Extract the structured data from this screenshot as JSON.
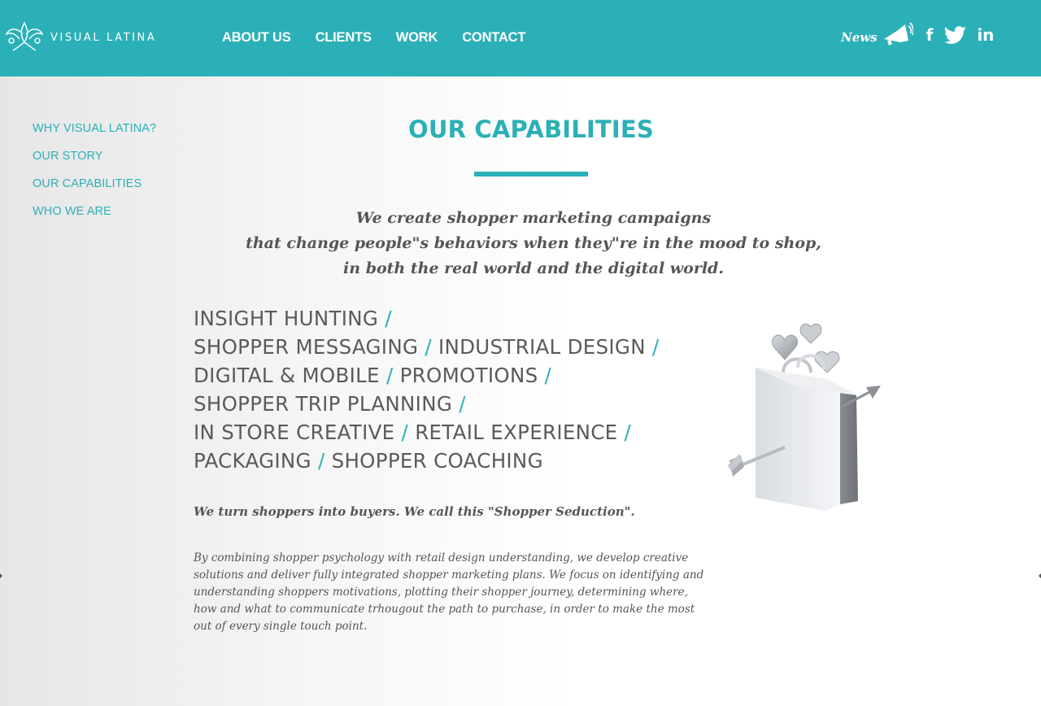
{
  "header": {
    "logo_text": "VISUAL LATINA",
    "nav": [
      "ABOUT US",
      "CLIENTS",
      "WORK",
      "CONTACT"
    ],
    "news_label": "News",
    "social_icons": [
      "megaphone-icon",
      "facebook-icon",
      "twitter-icon",
      "linkedin-icon"
    ],
    "facebook_glyph": "f",
    "linkedin_glyph": "in"
  },
  "sidebar": {
    "items": [
      "WHY VISUAL LATINA?",
      "OUR STORY",
      "OUR CAPABILITIES",
      "WHO WE ARE"
    ]
  },
  "main": {
    "title": "OUR CAPABILITIES",
    "intro_lines": [
      "We create shopper marketing campaigns",
      "that change people\"s behaviors when they\"re in the mood to shop,",
      "in both the real world and the digital world."
    ],
    "capabilities": [
      "INSIGHT HUNTING",
      "SHOPPER MESSAGING",
      "INDUSTRIAL DESIGN",
      "DIGITAL & MOBILE",
      "PROMOTIONS",
      "SHOPPER TRIP PLANNING",
      "IN STORE CREATIVE",
      "RETAIL EXPERIENCE",
      "PACKAGING",
      "SHOPPER COACHING"
    ],
    "separator": "/",
    "tagline": "We turn shoppers into buyers. We call this \"Shopper Seduction\".",
    "body": "By combining shopper psychology with retail design understanding, we develop creative solutions and deliver fully integrated shopper marketing plans. We focus on identifying and understanding shoppers motivations, plotting their shopper journey, determining where, how and what to communicate trhougout the path to purchase, in order to make the most out of every single touch point."
  },
  "colors": {
    "accent": "#2cb0b7",
    "text": "#555555"
  }
}
